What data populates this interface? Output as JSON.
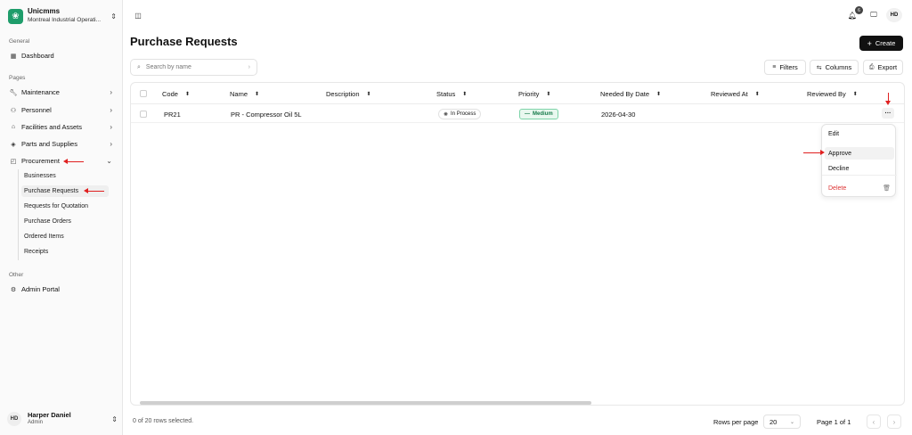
{
  "org": {
    "name": "Unicmms",
    "subtitle": "Montreal Industrial Operati..."
  },
  "sidebar": {
    "sections": {
      "general": "General",
      "pages": "Pages",
      "other": "Other"
    },
    "items": {
      "dashboard": "Dashboard",
      "maintenance": "Maintenance",
      "personnel": "Personnel",
      "facilities": "Facilities and Assets",
      "parts": "Parts and Supplies",
      "procurement": "Procurement",
      "admin": "Admin Portal"
    },
    "procurement_sub": [
      "Businesses",
      "Purchase Requests",
      "Requests for Quotation",
      "Purchase Orders",
      "Ordered Items",
      "Receipts"
    ]
  },
  "user": {
    "initials": "HD",
    "name": "Harper Daniel",
    "role": "Admin"
  },
  "header": {
    "notification_count": "6",
    "avatar_initials": "HD"
  },
  "page": {
    "title": "Purchase Requests",
    "create_label": "Create",
    "search_placeholder": "Search by name",
    "filters_label": "Filters",
    "columns_label": "Columns",
    "export_label": "Export"
  },
  "table": {
    "columns": [
      "Code",
      "Name",
      "Description",
      "Status",
      "Priority",
      "Needed By Date",
      "Reviewed At",
      "Reviewed By"
    ],
    "rows": [
      {
        "code": "PR21",
        "name": "PR - Compressor Oil 5L",
        "description": "",
        "status": "In Process",
        "priority": "Medium",
        "needed_by": "2026-04-30",
        "reviewed_at": "",
        "reviewed_by": ""
      }
    ]
  },
  "row_menu": {
    "edit": "Edit",
    "approve": "Approve",
    "decline": "Decline",
    "delete": "Delete"
  },
  "footer": {
    "selection": "0 of 20 rows selected.",
    "rows_per_page_label": "Rows per page",
    "rows_per_page_value": "20",
    "page_label": "Page 1 of 1"
  },
  "colors": {
    "accent": "#1f9d6b",
    "priority_bg": "#e9f8ef",
    "priority_text": "#167a4a",
    "danger": "#d33333",
    "annotation": "#e02020"
  }
}
